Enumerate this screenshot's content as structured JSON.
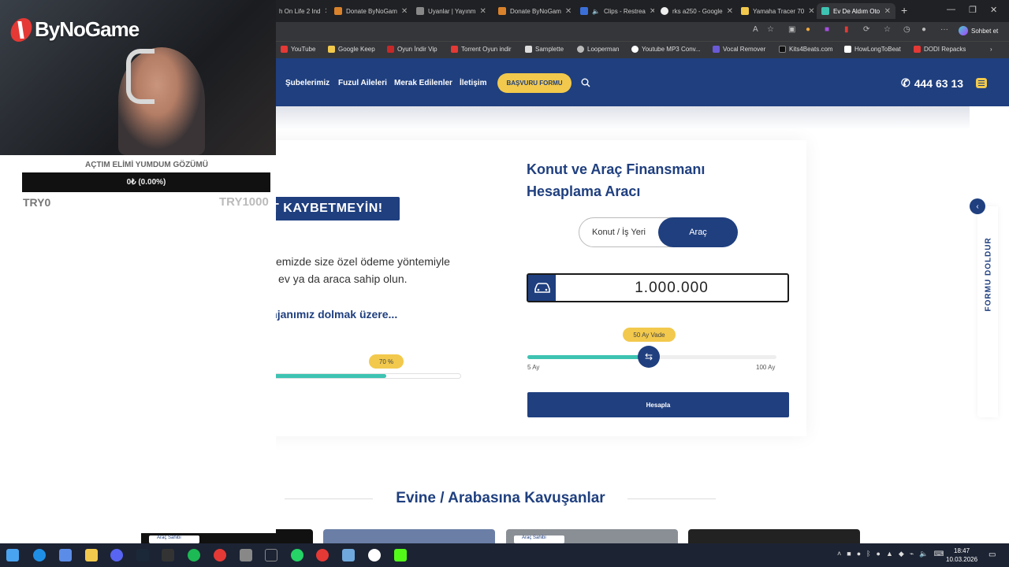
{
  "browser": {
    "tabs": [
      {
        "label": "h On Life 2 Ind",
        "active": false
      },
      {
        "label": "Donate ByNoGam",
        "active": false
      },
      {
        "label": "Uyanlar | Yayınm",
        "active": false
      },
      {
        "label": "Donate ByNoGam",
        "active": false
      },
      {
        "label": "Clips - Restrea",
        "active": false
      },
      {
        "label": "rks a250 - Google",
        "active": false
      },
      {
        "label": "Yamaha Tracer 70",
        "active": false
      },
      {
        "label": "Ev De Aldım Oto",
        "active": true
      }
    ],
    "sohbet_label": "Sohbet et",
    "bookmarks": [
      "YouTube",
      "Google Keep",
      "Oyun İndir Vip",
      "Torrent Oyun indir",
      "Samplette",
      "Looperman",
      "Youtube MP3 Conv...",
      "Vocal Remover",
      "Kits4Beats.com",
      "HowLongToBeat",
      "DODI Repacks"
    ]
  },
  "site": {
    "nav": [
      "Şubelerimiz",
      "Fuzul Aileleri",
      "Merak Edilenler",
      "İletişim"
    ],
    "apply_label": "BAŞVURU FORMU",
    "phone": "444 63 13",
    "banner": "VAKİT KAYBETMEYİN!",
    "description": "En yakın şubemizde size özel ödeme yöntemiyle hayalinizdeki ev ya da araca sahip olun.",
    "quota_text": "Aylık kontenjanımız dolmak üzere...",
    "quota_percent_label": "70 %",
    "quota_fraction": 0.7,
    "calc_title": "Konut ve Araç Finansmanı Hesaplama Aracı",
    "toggle": {
      "option_1": "Konut / İş Yeri",
      "option_2": "Araç",
      "selected": "Araç"
    },
    "amount_value": "1.000.000",
    "term": {
      "label": "50 Ay Vade",
      "min_label": "5 Ay",
      "max_label": "100 Ay",
      "min": 5,
      "max": 100,
      "value": 50
    },
    "calc_button": "Hesapla",
    "side_tab": "FORMU DOLDUR",
    "section_title": "Evine / Arabasına Kavuşanlar",
    "thumb_tag": "Araç Sahibi",
    "colors": {
      "primary": "#1f3f7f",
      "accent": "#f2c94c",
      "progress": "#3ec3b2"
    }
  },
  "overlay": {
    "brand": "ByNoGame",
    "goal_title": "AÇTIM ELİMİ YUMDUM GÖZÜMÜ",
    "goal_progress": "0₺ (0.00%)",
    "amount_left": "TRY0",
    "amount_right": "TRY1000"
  },
  "taskbar": {
    "time": "18:47",
    "date": "10.03.2026"
  }
}
